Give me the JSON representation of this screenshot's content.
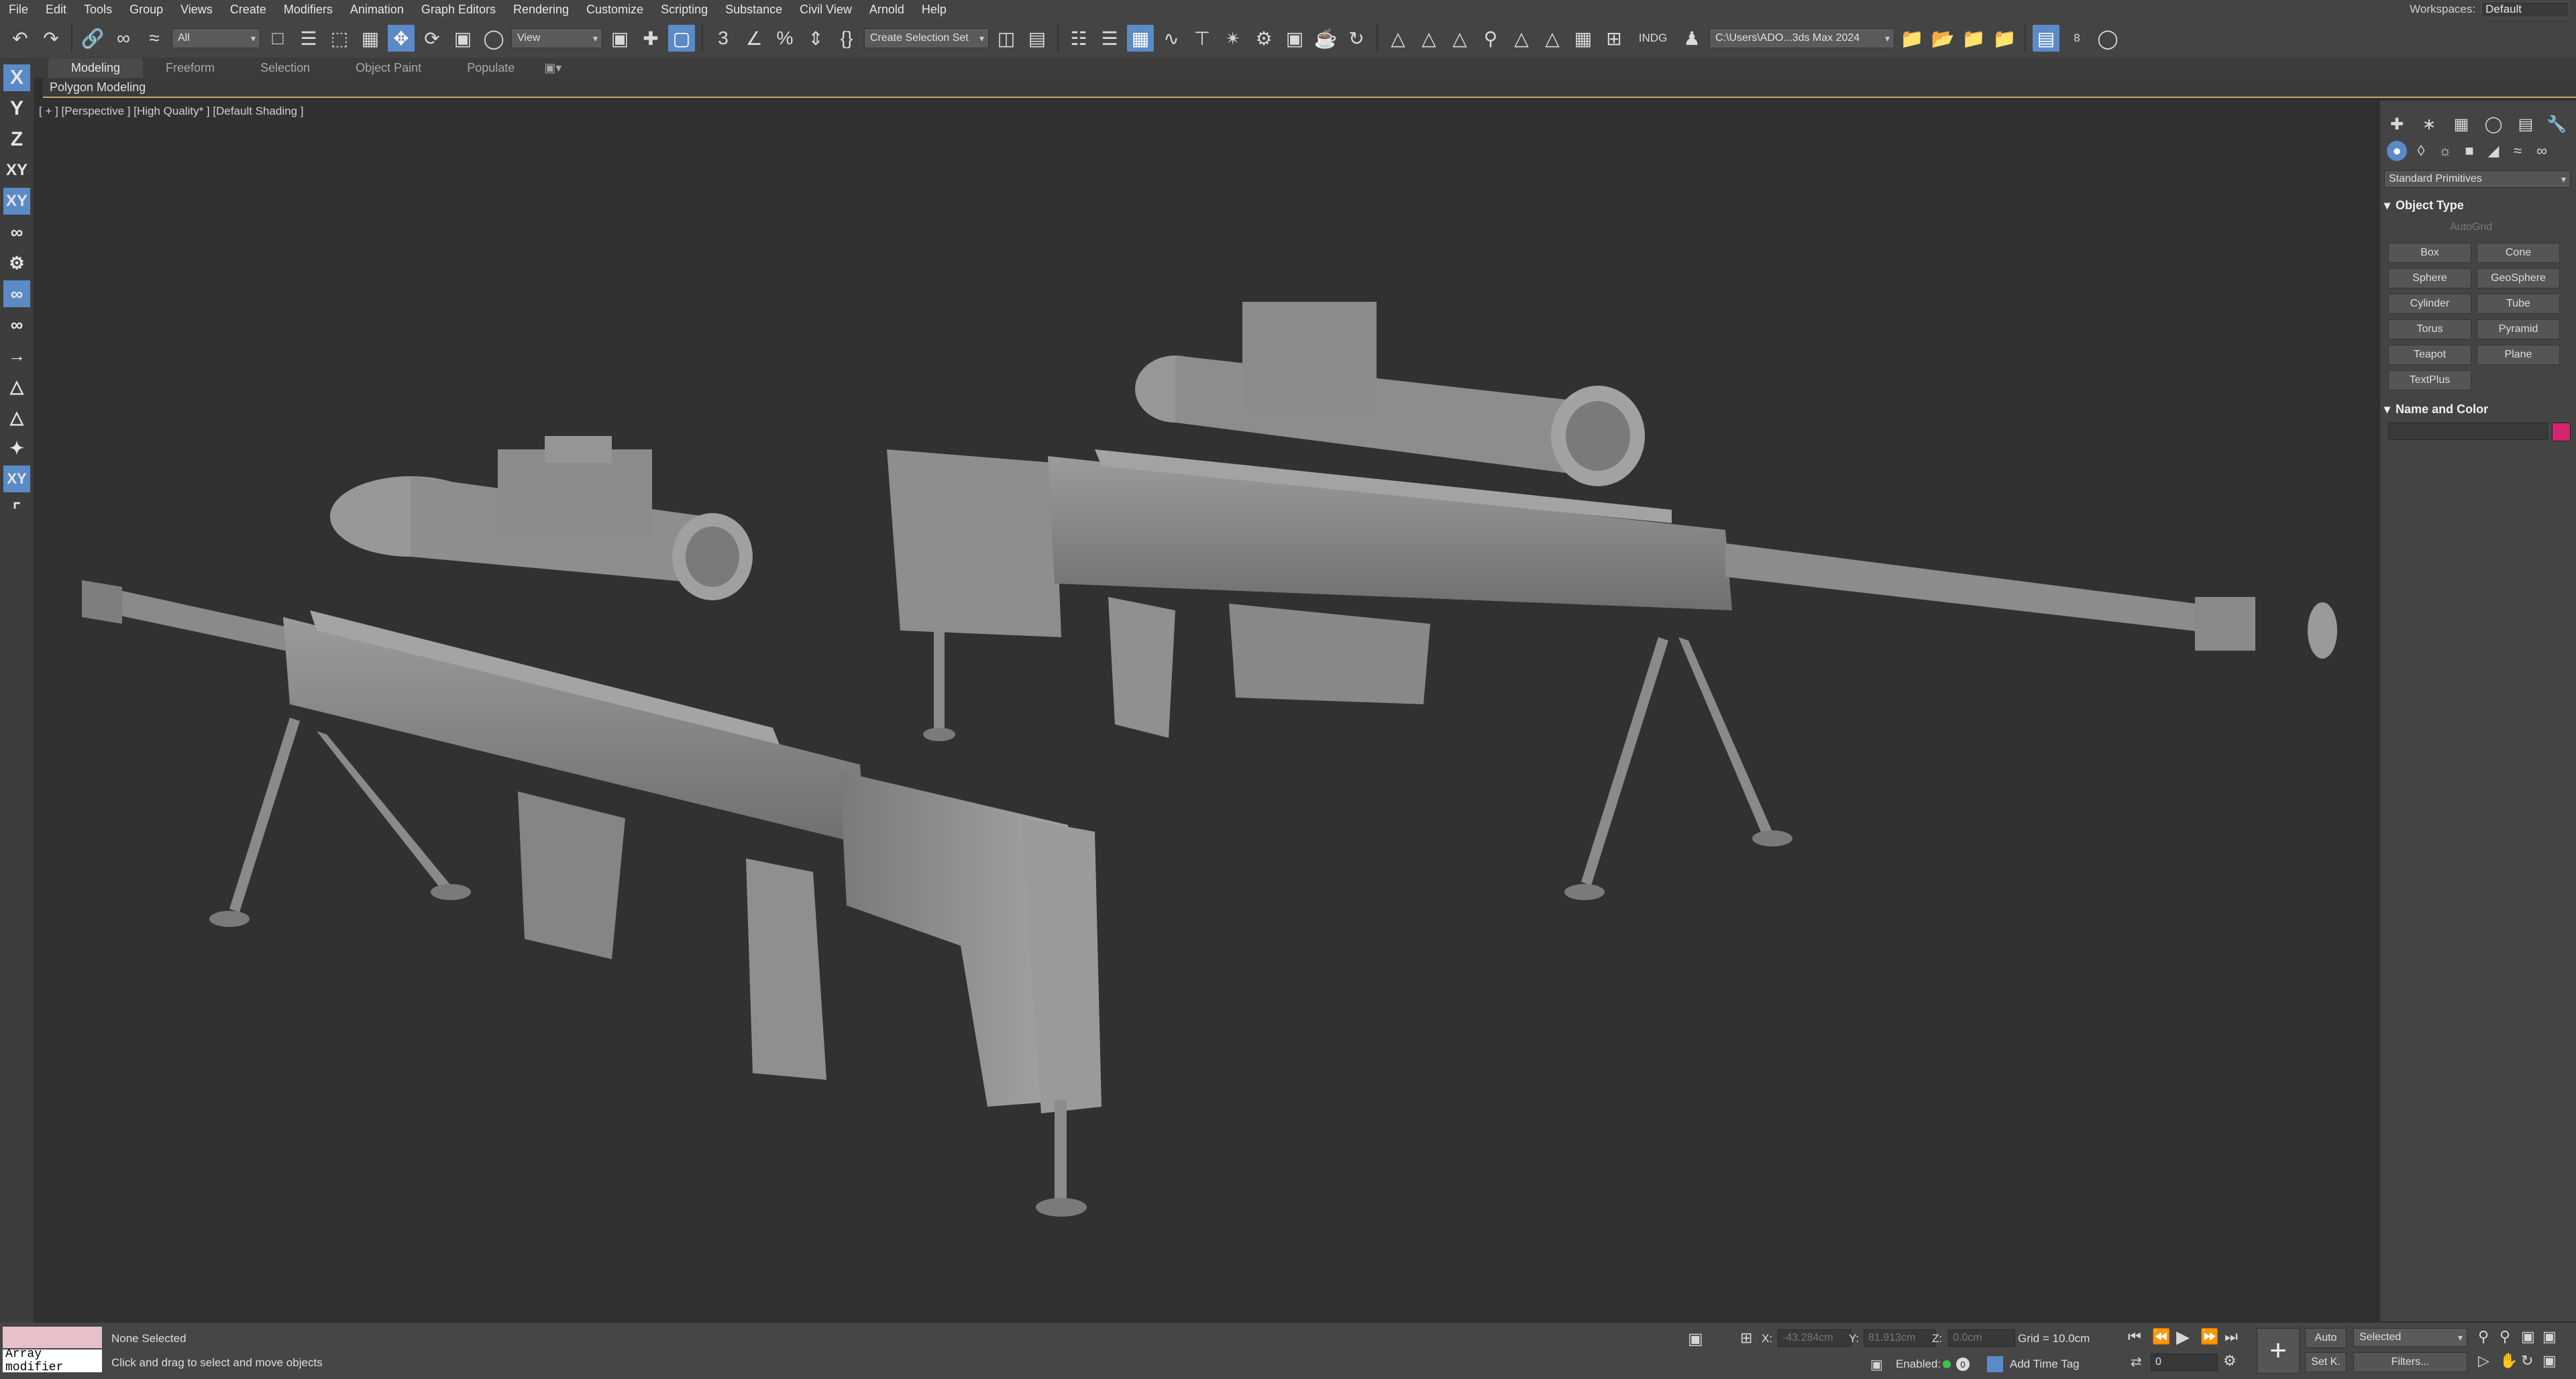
{
  "menu": [
    "File",
    "Edit",
    "Tools",
    "Group",
    "Views",
    "Create",
    "Modifiers",
    "Animation",
    "Graph Editors",
    "Rendering",
    "Customize",
    "Scripting",
    "Substance",
    "Civil View",
    "Arnold",
    "Help"
  ],
  "workspace": {
    "label": "Workspaces:",
    "value": "Default"
  },
  "toolbar": {
    "filter_value": "All",
    "refcoord_value": "View",
    "selection_set": "Create Selection Set",
    "indg_label": "INDG",
    "path_value": "C:\\Users\\ADO...3ds Max 2024",
    "badge_value": "8"
  },
  "ribbon": {
    "tabs": [
      "Modeling",
      "Freeform",
      "Selection",
      "Object Paint",
      "Populate"
    ],
    "active_tab": "Modeling",
    "sub_label": "Polygon Modeling"
  },
  "left_toolbar": [
    "X",
    "Y",
    "Z",
    "XY",
    "XY"
  ],
  "viewport": {
    "label": "[ + ] [Perspective ] [High Quality* ] [Default Shading ]"
  },
  "command_panel": {
    "category": "Standard Primitives",
    "object_type_header": "Object Type",
    "autogrid": "AutoGrid",
    "buttons": [
      "Box",
      "Cone",
      "Sphere",
      "GeoSphere",
      "Cylinder",
      "Tube",
      "Torus",
      "Pyramid",
      "Teapot",
      "Plane",
      "TextPlus"
    ],
    "name_color_header": "Name and Color",
    "swatch_color": "#d6246e"
  },
  "status": {
    "script_label": "Array modifier",
    "selection_state": "None Selected",
    "prompt": "Click and drag to select and move objects",
    "x_label": "X:",
    "x_value": "-43.284cm",
    "y_label": "Y:",
    "y_value": "81.913cm",
    "z_label": "Z:",
    "z_value": "0.0cm",
    "grid": "Grid = 10.0cm",
    "enabled_label": "Enabled:",
    "add_time_tag": "Add Time Tag",
    "auto_label": "Auto",
    "selected_value": "Selected",
    "setk_label": "Set K.",
    "filters_label": "Filters...",
    "frame_value": "0"
  },
  "colors": {
    "accent": "#5b8ac7",
    "background": "#2f2f2f",
    "model": "#8e8e8e"
  }
}
